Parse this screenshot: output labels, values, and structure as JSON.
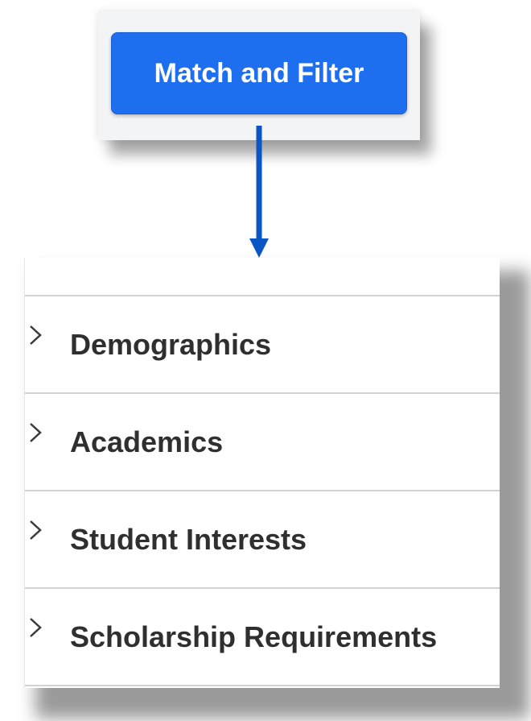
{
  "button": {
    "label": "Match and Filter",
    "color": "#1e6ff0"
  },
  "connector": {
    "color": "#0b56c4"
  },
  "accordion": {
    "items": [
      {
        "label": "Demographics",
        "icon": "chevron-right-icon"
      },
      {
        "label": "Academics",
        "icon": "chevron-right-icon"
      },
      {
        "label": "Student Interests",
        "icon": "chevron-right-icon"
      },
      {
        "label": "Scholarship Requirements",
        "icon": "chevron-right-icon"
      }
    ]
  }
}
